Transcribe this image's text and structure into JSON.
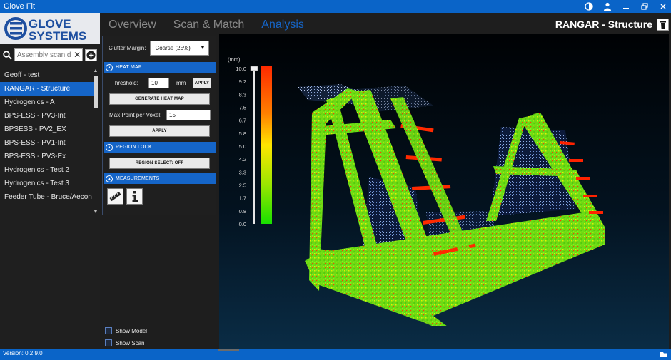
{
  "app": {
    "title": "Glove Fit"
  },
  "logo": {
    "line1": "GLOVE",
    "line2": "SYSTEMS"
  },
  "search": {
    "placeholder": "Assembly scanId",
    "value": ""
  },
  "assemblies": [
    {
      "label": "Geoff - test",
      "selected": false
    },
    {
      "label": "RANGAR - Structure",
      "selected": true
    },
    {
      "label": "Hydrogenics - A",
      "selected": false
    },
    {
      "label": "BPS-ESS - PV3-Int",
      "selected": false
    },
    {
      "label": "BPSESS - PV2_EX",
      "selected": false
    },
    {
      "label": "BPS-ESS - PV1-Int",
      "selected": false
    },
    {
      "label": "BPS-ESS - PV3-Ex",
      "selected": false
    },
    {
      "label": "Hydrogenics - Test 2",
      "selected": false
    },
    {
      "label": "Hydrogenics - Test 3",
      "selected": false
    },
    {
      "label": "Feeder Tube - Bruce/Aecon",
      "selected": false
    }
  ],
  "tabs": [
    {
      "label": "Overview",
      "active": false
    },
    {
      "label": "Scan & Match",
      "active": false
    },
    {
      "label": "Analysis",
      "active": true
    }
  ],
  "structure_title": "RANGAR - Structure",
  "controls": {
    "clutter_label": "Clutter Margin:",
    "clutter_value": "Coarse (25%)",
    "heatmap_section": "HEAT MAP",
    "threshold_label": "Threshold:",
    "threshold_value": "10",
    "threshold_unit": "mm",
    "apply_label": "APPLY",
    "generate_label": "GENERATE HEAT MAP",
    "max_point_label": "Max Point per Voxel:",
    "max_point_value": "15",
    "apply2_label": "APPLY",
    "region_section": "REGION LOCK",
    "region_select_label": "REGION SELECT: OFF",
    "measure_section": "MEASUREMENTS"
  },
  "toggles": [
    {
      "label": "Show Model",
      "checked": false
    },
    {
      "label": "Show Scan",
      "checked": false
    }
  ],
  "colorbar": {
    "unit": "(mm)",
    "ticks": [
      "10.0",
      "9.2",
      "8.3",
      "7.5",
      "6.7",
      "5.8",
      "5.0",
      "4.2",
      "3.3",
      "2.5",
      "1.7",
      "0.8",
      "0.0"
    ],
    "slider_value": 10.0,
    "colors": [
      "#ff2a00",
      "#ff8000",
      "#ffe600",
      "#9be600",
      "#18e000"
    ]
  },
  "status": {
    "version": "Version: 0.2.9.0"
  }
}
